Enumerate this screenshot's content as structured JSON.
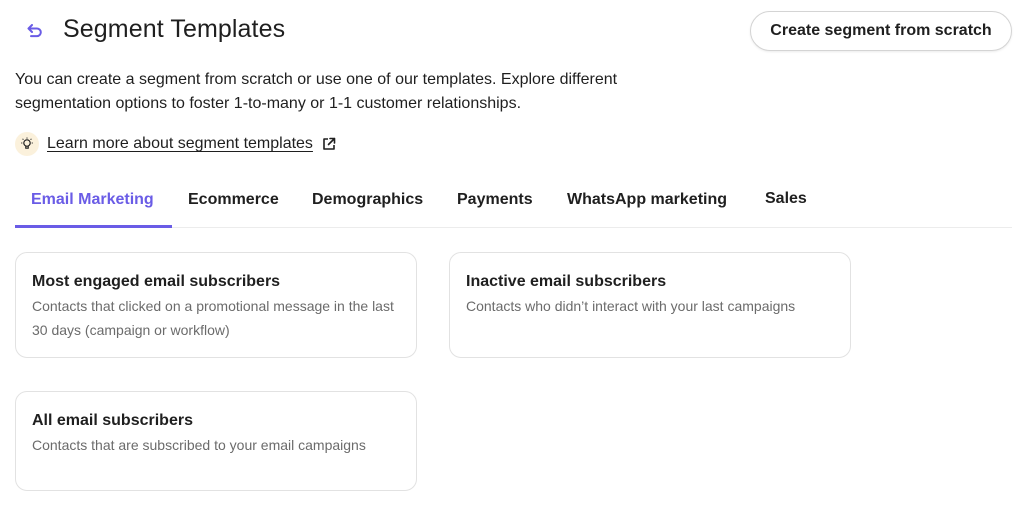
{
  "header": {
    "back_icon": "undo-arrow-icon",
    "title": "Segment Templates",
    "create_button_label": "Create segment from scratch"
  },
  "intro": {
    "text": "You can create a segment from scratch or use one of our templates. Explore different segmentation options to foster 1-to-many or 1-1 customer relationships."
  },
  "learn_more": {
    "icon": "lightbulb-icon",
    "label": "Learn more about segment templates",
    "external_icon": "external-link-icon"
  },
  "tabs": [
    {
      "label": "Email Marketing",
      "active": true
    },
    {
      "label": "Ecommerce",
      "active": false
    },
    {
      "label": "Demographics",
      "active": false
    },
    {
      "label": "Payments",
      "active": false
    },
    {
      "label": "WhatsApp marketing",
      "active": false
    },
    {
      "label": "Sales",
      "active": false
    }
  ],
  "cards": [
    {
      "title": "Most engaged email subscribers",
      "description": "Contacts that clicked on a promotional message in the last 30 days (campaign or workflow)"
    },
    {
      "title": "Inactive email subscribers",
      "description": "Contacts who didn’t interact with your last campaigns"
    },
    {
      "title": "All email subscribers",
      "description": "Contacts that are subscribed to your email campaigns"
    }
  ],
  "colors": {
    "accent": "#6a5ce6",
    "text_primary": "#1f1f1f",
    "text_secondary": "#6b6b6b",
    "border": "#e2e2e2",
    "bulb_bg": "#fbf1dc"
  }
}
